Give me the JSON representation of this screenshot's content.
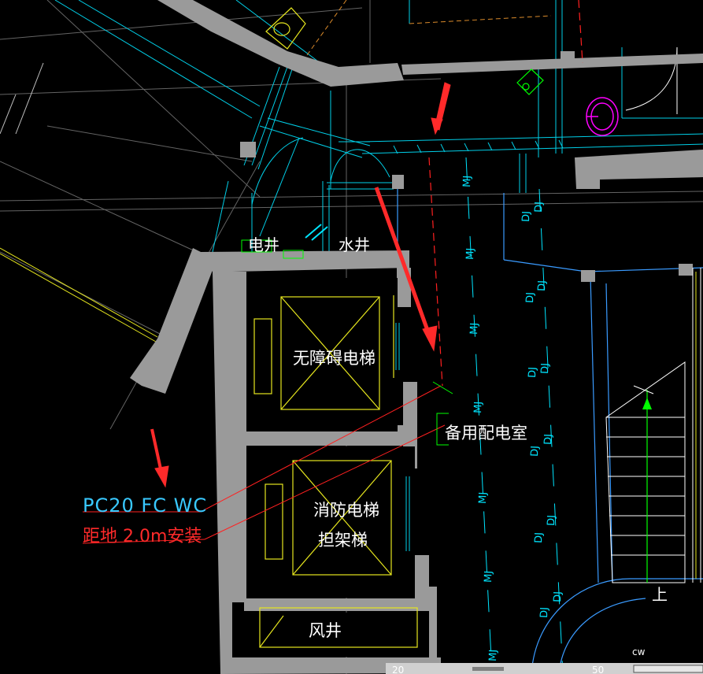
{
  "drawing": {
    "background": "#000000",
    "colors": {
      "wall": "#9a9a9a",
      "cyan": "#00e5ff",
      "yellow": "#ffff00",
      "red": "#ff2020",
      "white": "#ffffff",
      "green": "#00ff00",
      "magenta": "#ff00ff",
      "blue_label": "#3a9bff"
    },
    "labels": {
      "elec_shaft": "电井",
      "water_shaft": "水井",
      "elevator_accessible": "无障碍电梯",
      "spare_room": "备用配电室",
      "fire_elevator_line1": "消防电梯",
      "fire_elevator_line2": "担架梯",
      "air_shaft": "风井",
      "annotation_line1": "PC20 FC WC",
      "annotation_line2": "距地 2.0m安装",
      "stair_up": "上",
      "tag_bottom": "cw",
      "status_left": "20",
      "status_right": "50"
    },
    "mj_tag": "MJ",
    "dj_tag": "DJ"
  }
}
